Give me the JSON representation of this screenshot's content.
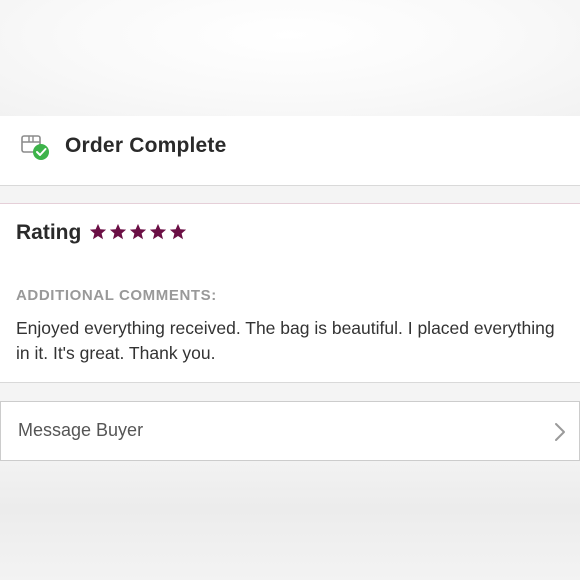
{
  "order_status": {
    "icon": "package-check-icon",
    "title": "Order Complete"
  },
  "rating": {
    "label": "Rating",
    "stars": 5,
    "max_stars": 5,
    "star_color": "#6b0f45"
  },
  "comments": {
    "label": "ADDITIONAL COMMENTS:",
    "text": "Enjoyed everything received. The bag is beautiful. I placed everything in it. It's great. Thank you."
  },
  "actions": {
    "message_buyer_label": "Message Buyer",
    "chevron_icon": "chevron-right-icon"
  },
  "colors": {
    "success_green": "#3db34a",
    "divider": "#d9d9d9"
  }
}
